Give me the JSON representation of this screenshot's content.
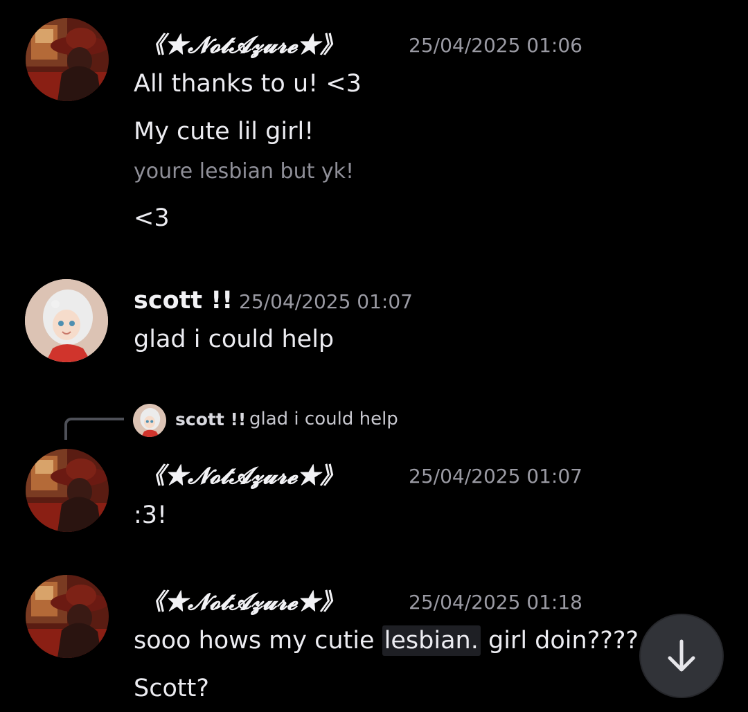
{
  "messages": [
    {
      "username": "《★𝓝𝓸𝓽𝓐𝔃𝓾𝓻𝓮★》",
      "timestamp": "25/04/2025 01:06",
      "lines": [
        "All thanks to u! <3",
        "My cute lil girl!",
        "youre lesbian but yk!",
        "<3"
      ]
    },
    {
      "username": "scott !!",
      "timestamp": "25/04/2025 01:07",
      "lines": [
        "glad i could help"
      ]
    },
    {
      "reply": {
        "username": "scott !!",
        "text": "glad i could help"
      },
      "username": "《★𝓝𝓸𝓽𝓐𝔃𝓾𝓻𝓮★》",
      "timestamp": "25/04/2025 01:07",
      "lines": [
        ":3!"
      ]
    },
    {
      "username": "《★𝓝𝓸𝓽𝓐𝔃𝓾𝓻𝓮★》",
      "timestamp": "25/04/2025 01:18",
      "lines_parts": {
        "before": "sooo hows my cutie ",
        "highlight": "lesbian.",
        "after": " girl doin????"
      },
      "lines": [
        "Scott?"
      ]
    }
  ],
  "jump_button_icon": "arrow-down-icon",
  "colors": {
    "background": "#000000",
    "text": "#ececf1",
    "muted": "#9a9aa3",
    "button": "#313338"
  }
}
